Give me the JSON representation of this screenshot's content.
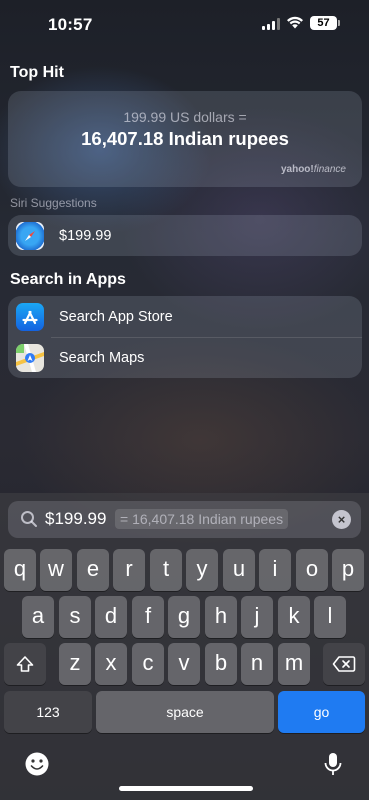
{
  "status_bar": {
    "time": "10:57",
    "battery": "57"
  },
  "top_hit": {
    "title": "Top Hit",
    "conversion_from": "199.99 US dollars =",
    "conversion_to": "16,407.18 Indian rupees",
    "source_brand": "yahoo!",
    "source_suffix": "finance"
  },
  "siri_suggestions": {
    "title": "Siri Suggestions",
    "items": [
      {
        "label": "$199.99",
        "icon": "safari-icon"
      }
    ]
  },
  "search_in_apps": {
    "title": "Search in Apps",
    "items": [
      {
        "label": "Search App Store",
        "icon": "app-store-icon"
      },
      {
        "label": "Search Maps",
        "icon": "maps-icon"
      }
    ]
  },
  "search": {
    "query": "$199.99",
    "inline_suggestion": "= 16,407.18 Indian rupees"
  },
  "keyboard": {
    "row1": [
      "q",
      "w",
      "e",
      "r",
      "t",
      "y",
      "u",
      "i",
      "o",
      "p"
    ],
    "row2": [
      "a",
      "s",
      "d",
      "f",
      "g",
      "h",
      "j",
      "k",
      "l"
    ],
    "row3": [
      "z",
      "x",
      "c",
      "v",
      "b",
      "n",
      "m"
    ],
    "numbers_key": "123",
    "space_key": "space",
    "go_key": "go"
  },
  "colors": {
    "go_key": "#1f7bf2"
  }
}
